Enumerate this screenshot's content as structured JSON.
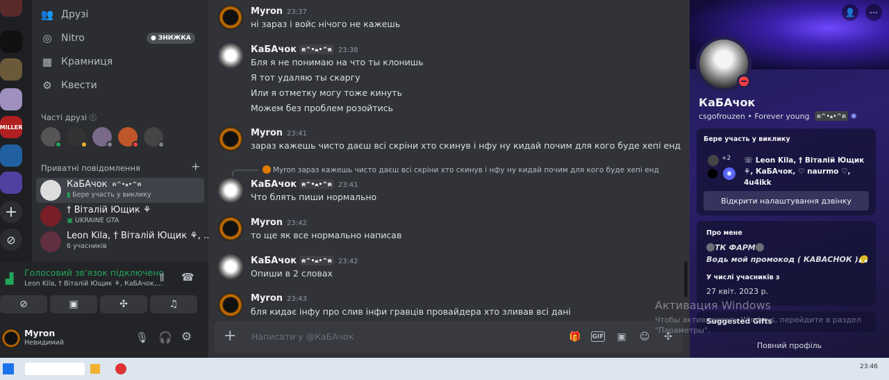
{
  "nav": {
    "friends": "Друзі",
    "nitro": "Nitro",
    "nitro_badge": "ЗНИЖКА",
    "shop": "Крамниця",
    "quests": "Квести"
  },
  "frequent_friends_title": "Часті друзі",
  "dm_title": "Приватні повідомлення",
  "dm_list": [
    {
      "name": "КаБАчок",
      "tag": "ฅ^•ﻌ•^ฅ",
      "sub": "Бере участь у виклику"
    },
    {
      "name": "† Віталій Ющик ⚘",
      "sub": "UKRAINE GTA"
    },
    {
      "name": "Leon Kila, † Віталій Ющик ⚘, ...",
      "sub": "6 учасників"
    }
  ],
  "voice": {
    "status": "Голосовий зв'язок підключено",
    "participants": "Leon Kila, † Віталій Ющик ⚘, КаБАчок,..."
  },
  "user": {
    "name": "Myron",
    "status": "Невидимий"
  },
  "messages": [
    {
      "author": "Myron",
      "time": "23:37",
      "lines": [
        "ні зараз і войс нічого не кажешь"
      ]
    },
    {
      "author": "КаБАчок",
      "tag": "ฅ^•ﻌ•^ฅ",
      "time": "23:38",
      "lines": [
        "Бля я не понимаю на что ты клонишь",
        "Я тот удаляю ты скаргу",
        "Или я отметку могу тоже кинуть",
        "Можем без проблем розойтись"
      ]
    },
    {
      "author": "Myron",
      "time": "23:41",
      "lines": [
        "зараз кажешь чисто даєш всі скріни хто скинув і нфу ну кидай почим для кого буде хепі енд"
      ]
    },
    {
      "author": "КаБАчок",
      "tag": "ฅ^•ﻌ•^ฅ",
      "time": "23:41",
      "lines": [
        "Что блять пиши нормально"
      ],
      "reply": "Myron зараз кажешь чисто даєш всі скріни хто скинув і нфу ну кидай почим для кого буде хепі енд"
    },
    {
      "author": "Myron",
      "time": "23:42",
      "lines": [
        "то ще як все нормально написав"
      ]
    },
    {
      "author": "КаБАчок",
      "tag": "ฅ^•ﻌ•^ฅ",
      "time": "23:42",
      "lines": [
        "Опиши в 2 словах"
      ]
    },
    {
      "author": "Myron",
      "time": "23:43",
      "lines": [
        "бля кидає інфу про слив інфи гравців провайдера  хто зливав  всі дані"
      ]
    }
  ],
  "composer": {
    "placeholder": "Написати у @КаБАчок"
  },
  "profile": {
    "name": "КаБАчок",
    "username": "csgofrouzen",
    "tagline": "Forever young",
    "tag": "ฅ^•ﻌ•^ฅ",
    "in_call_label": "Бере участь у виклику",
    "call_extra": "+2",
    "call_members": "Leon Kila, † Віталій Ющик ⚘, КаБАчок, ♡ naurmo ♡, 4u4ikk",
    "call_settings_button": "Відкрити налаштування дзвінку",
    "about_label": "Про мене",
    "about_line1": "ТК ФАРМ",
    "about_line2": "Водь мой промокод ( КАВАСНОК )😤",
    "member_since_label": "У числі учасників з",
    "member_since": "27 квіт. 2023 р.",
    "gifts_label": "Suggested Gifts",
    "full_profile": "Повний профіль"
  },
  "watermark": {
    "title": "Активация Windows",
    "text": "Чтобы активировать Windows, перейдите в раздел \"Параметры\"."
  },
  "taskbar": {
    "clock": "23:46"
  },
  "colors": {
    "accent": "#5865f2",
    "online_green": "#23a55a",
    "dnd_red": "#f23f43",
    "voice_green": "#23a55a"
  }
}
